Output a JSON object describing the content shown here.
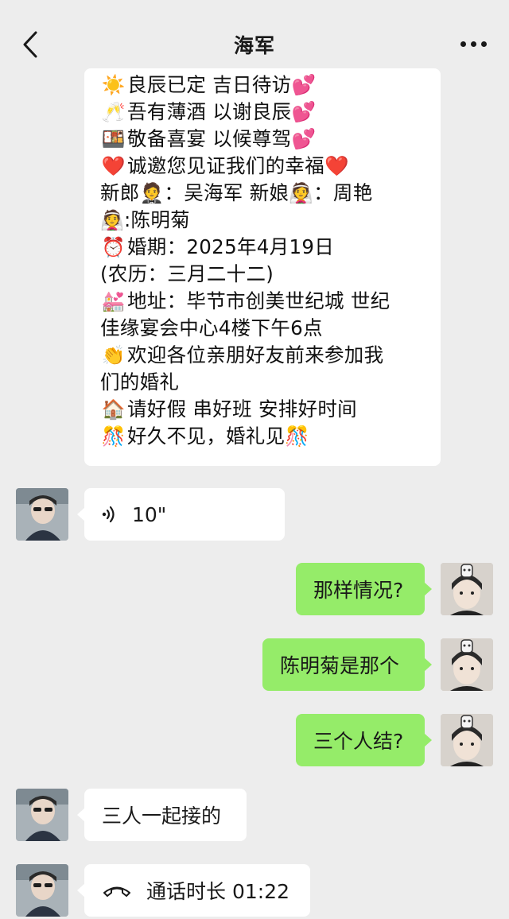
{
  "header": {
    "title": "海军",
    "back_icon": "chevron-left-icon",
    "more_icon": "ellipsis-icon"
  },
  "invitation": {
    "lines": [
      {
        "emoji": "☀️",
        "text": "良辰已定 吉日待访",
        "trail": "💕"
      },
      {
        "emoji": "🥂",
        "text": "吾有薄酒 以谢良辰",
        "trail": "💕"
      },
      {
        "emoji": "🍱",
        "text": "敬备喜宴 以候尊驾",
        "trail": "💕"
      },
      {
        "emoji": "❤️",
        "text": "诚邀您见证我们的幸福",
        "trail": "❤️"
      },
      {
        "emoji": "",
        "text": "新郎🤵：吴海军  新娘👰：周艳",
        "trail": ""
      },
      {
        "emoji": "👰",
        "text": " :陈明菊",
        "trail": ""
      },
      {
        "emoji": "⏰",
        "text": "婚期：2025年4月19日",
        "trail": ""
      },
      {
        "emoji": "",
        "text": "(农历：三月二十二)",
        "trail": ""
      },
      {
        "emoji": "💒",
        "text": "地址：毕节市创美世纪城 世纪",
        "trail": ""
      },
      {
        "emoji": "",
        "text": "佳缘宴会中心4楼下午6点",
        "trail": ""
      },
      {
        "emoji": "👏",
        "text": "欢迎各位亲朋好友前来参加我",
        "trail": ""
      },
      {
        "emoji": "",
        "text": "们的婚礼",
        "trail": ""
      },
      {
        "emoji": "🏠",
        "text": "请好假 串好班 安排好时间",
        "trail": ""
      },
      {
        "emoji": "🎊",
        "text": "好久不见，婚礼见",
        "trail": "🎊"
      }
    ]
  },
  "messages": [
    {
      "side": "left",
      "type": "voice",
      "text": "10\"",
      "icon": "voice-icon"
    },
    {
      "side": "right",
      "type": "text",
      "text": "那样情况?"
    },
    {
      "side": "right",
      "type": "text",
      "text": "陈明菊是那个"
    },
    {
      "side": "right",
      "type": "text",
      "text": "三个人结?"
    },
    {
      "side": "left",
      "type": "text",
      "text": "三人一起接的"
    },
    {
      "side": "left",
      "type": "call",
      "text": "通话时长 01:22",
      "icon": "phone-icon"
    }
  ],
  "colors": {
    "background": "#ededed",
    "bubble_left": "#ffffff",
    "bubble_right": "#95ec69"
  }
}
